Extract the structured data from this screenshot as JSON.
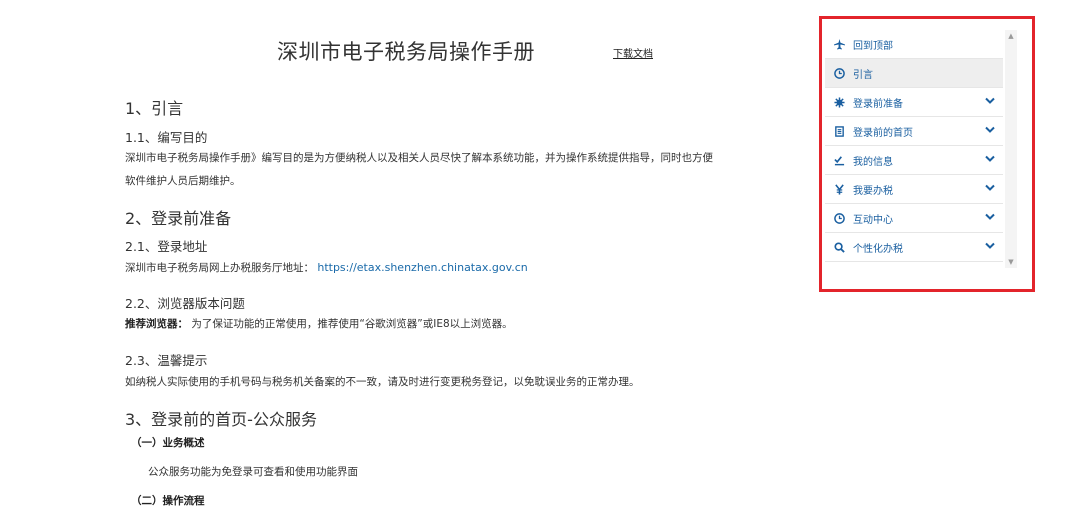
{
  "doc": {
    "title": "深圳市电子税务局操作手册",
    "download_label": "下载文档",
    "sections": {
      "s1": "1、引言",
      "s1_1": "1.1、编写目的",
      "s1_1_text_line1": "深圳市电子税务局操作手册》编写目的是为方便纳税人以及相关人员尽快了解本系统功能，并为操作系统提供指导，同时也方便",
      "s1_1_text_line2": "软件维护人员后期维护。",
      "s2": "2、登录前准备",
      "s2_1": "2.1、登录地址",
      "s2_1_label": "深圳市电子税务局网上办税服务厅地址：",
      "s2_1_url": "https://etax.shenzhen.chinatax.gov.cn",
      "s2_2": "2.2、浏览器版本问题",
      "s2_2_bold": "推荐浏览器：",
      "s2_2_text": "为了保证功能的正常使用，推荐使用“谷歌浏览器”或IE8以上浏览器。",
      "s2_3": "2.3、温馨提示",
      "s2_3_text": "如纳税人实际使用的手机号码与税务机关备案的不一致，请及时进行变更税务登记，以免耽误业务的正常办理。",
      "s3": "3、登录前的首页-公众服务",
      "s3_sub1": "（一）业务概述",
      "s3_sub1_text": "公众服务功能为免登录可查看和使用功能界面",
      "s3_sub2": "（二）操作流程"
    }
  },
  "side_nav": {
    "accent_color": "#1a5fa0",
    "frame_color": "#e3242b",
    "items": [
      {
        "label": "回到顶部",
        "icon": "plane-icon"
      },
      {
        "label": "引言",
        "icon": "clock-icon"
      },
      {
        "label": "登录前准备",
        "icon": "gear-icon"
      },
      {
        "label": "登录前的首页",
        "icon": "document-icon"
      },
      {
        "label": "我的信息",
        "icon": "checklist-icon"
      },
      {
        "label": "我要办税",
        "icon": "yen-icon"
      },
      {
        "label": "互动中心",
        "icon": "clock-icon"
      },
      {
        "label": "个性化办税",
        "icon": "search-icon"
      }
    ]
  }
}
